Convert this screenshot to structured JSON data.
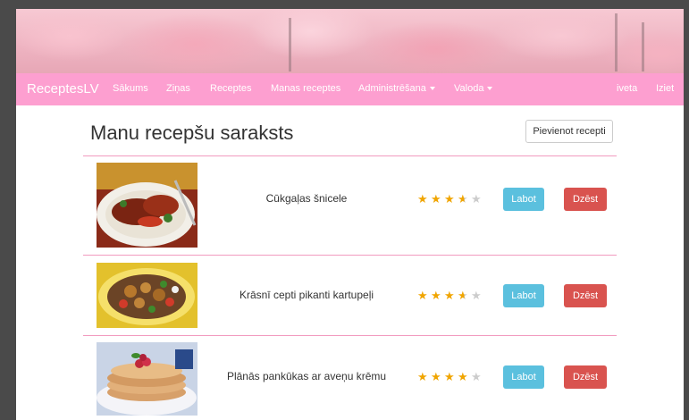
{
  "brand": "ReceptesLV",
  "nav": {
    "items": [
      "Sākums",
      "Ziņas",
      "Receptes",
      "Manas receptes"
    ],
    "dropdowns": [
      "Administrēšana",
      "Valoda"
    ],
    "user": "iveta",
    "logout": "Iziet"
  },
  "page": {
    "title": "Manu recepšu saraksts",
    "add_button": "Pievienot recepti"
  },
  "recipes": [
    {
      "name": "Cūkgaļas šnicele",
      "rating": 3.5,
      "edit": "Labot",
      "delete": "Dzēst"
    },
    {
      "name": "Krāsnī cepti pikanti kartupeļi",
      "rating": 3.5,
      "edit": "Labot",
      "delete": "Dzēst"
    },
    {
      "name": "Plānās pankūkas ar aveņu krēmu",
      "rating": 4,
      "edit": "Labot",
      "delete": "Dzēst"
    }
  ],
  "colors": {
    "navbar": "#fd9fd0",
    "edit_button": "#5bc0de",
    "delete_button": "#d9534f",
    "star_filled": "#f0a500",
    "star_empty": "#cccccc"
  },
  "icons": {
    "rating": "star-icon",
    "dropdown": "caret-down-icon"
  }
}
